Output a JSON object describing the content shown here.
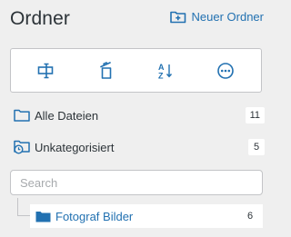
{
  "header": {
    "title": "Ordner",
    "new_folder_label": "Neuer Ordner"
  },
  "toolbar": {
    "buttons": [
      {
        "icon": "rename-icon"
      },
      {
        "icon": "delete-icon"
      },
      {
        "icon": "sort-az-icon"
      },
      {
        "icon": "more-options-icon"
      }
    ]
  },
  "folders": {
    "all_files": {
      "label": "Alle Dateien",
      "count": "11"
    },
    "uncategorized": {
      "label": "Unkategorisiert",
      "count": "5"
    }
  },
  "search": {
    "placeholder": "Search",
    "value": ""
  },
  "tree": {
    "items": [
      {
        "label": "Fotograf Bilder",
        "count": "6"
      }
    ]
  },
  "colors": {
    "accent": "#2271b1",
    "background": "#efefef",
    "text": "#2c3338"
  }
}
